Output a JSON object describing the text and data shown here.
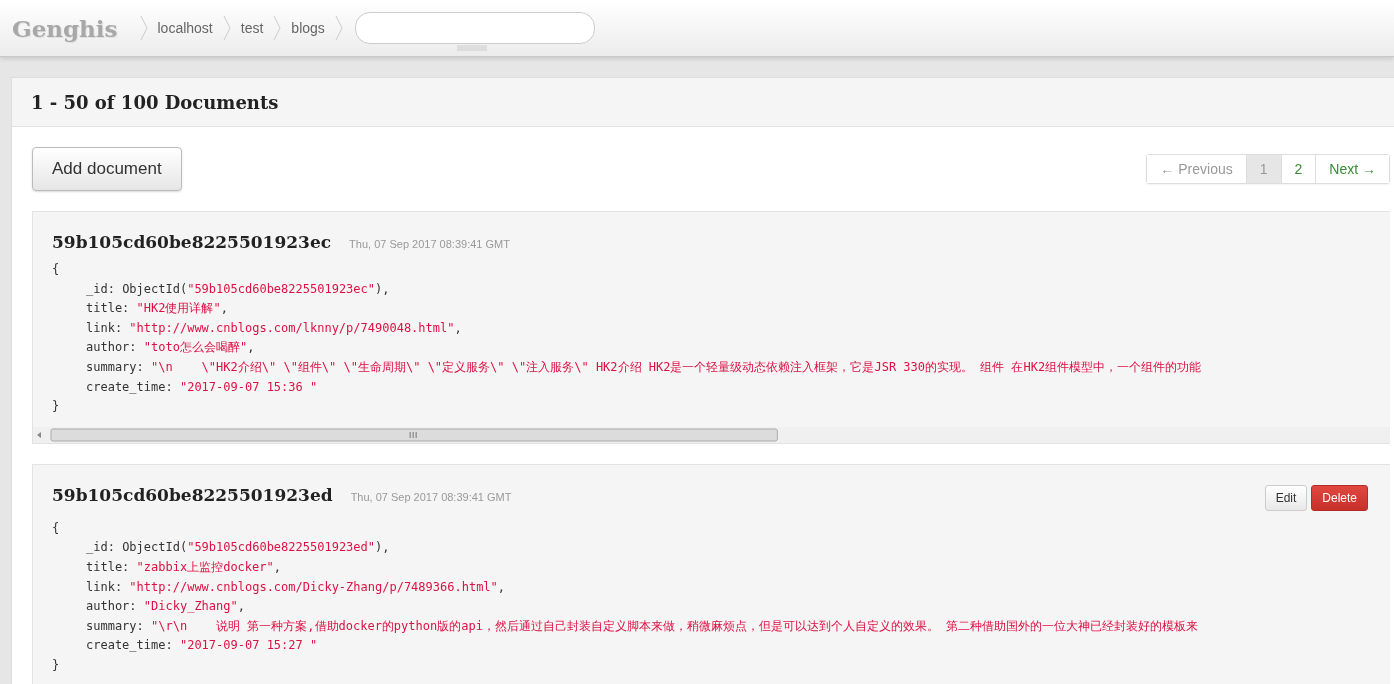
{
  "header": {
    "logo": "Genghis",
    "breadcrumbs": [
      "localhost",
      "test",
      "blogs"
    ]
  },
  "panel": {
    "title": "1 - 50 of 100 Documents",
    "add_button": "Add document",
    "pagination": [
      {
        "label": "← Previous",
        "disabled": true,
        "selected": false
      },
      {
        "label": "1",
        "disabled": false,
        "selected": true
      },
      {
        "label": "2",
        "disabled": false,
        "selected": false
      },
      {
        "label": "Next →",
        "disabled": false,
        "selected": false
      }
    ],
    "documents": [
      {
        "heading": "59b105cd60be8225501923ec",
        "timestamp": "Thu, 07 Sep 2017 08:39:41 GMT",
        "open": "{",
        "close": "}",
        "lines": [
          {
            "key": "_id:",
            "before": "ObjectId(",
            "value": "\"59b105cd60be8225501923ec\"",
            "after": "),"
          },
          {
            "key": "title:",
            "value": "\"HK2使用详解\"",
            "after": ","
          },
          {
            "key": "link:",
            "value": "\"http://www.cnblogs.com/lknny/p/7490048.html\"",
            "after": ","
          },
          {
            "key": "author:",
            "value": "\"toto怎么会喝醉\"",
            "after": ","
          },
          {
            "key": "summary:",
            "value": "\"\\n    \\\"HK2介绍\\\" \\\"组件\\\" \\\"生命周期\\\" \\\"定义服务\\\" \\\"注入服务\\\" HK2介绍 HK2是一个轻量级动态依赖注入框架，它是JSR 330的实现。 组件 在HK2组件模型中，一个组件的功能"
          },
          {
            "key": "create_time:",
            "value": "\"2017-09-07 15:36 \""
          }
        ]
      },
      {
        "heading": "59b105cd60be8225501923ed",
        "timestamp": "Thu, 07 Sep 2017 08:39:41 GMT",
        "actions": [
          {
            "label": "Edit",
            "kind": "edit"
          },
          {
            "label": "Delete",
            "kind": "delete"
          }
        ],
        "open": "{",
        "close": "}",
        "lines": [
          {
            "key": "_id:",
            "before": "ObjectId(",
            "value": "\"59b105cd60be8225501923ed\"",
            "after": "),"
          },
          {
            "key": "title:",
            "value": "\"zabbix上监控docker\"",
            "after": ","
          },
          {
            "key": "link:",
            "value": "\"http://www.cnblogs.com/Dicky-Zhang/p/7489366.html\"",
            "after": ","
          },
          {
            "key": "author:",
            "value": "\"Dicky_Zhang\"",
            "after": ","
          },
          {
            "key": "summary:",
            "value": "\"\\r\\n    说明 第一种方案,借助docker的python版的api，然后通过自己封装自定义脚本来做，稍微麻烦点，但是可以达到个人自定义的效果。 第二种借助国外的一位大神已经封装好的模板来"
          },
          {
            "key": "create_time:",
            "value": "\"2017-09-07 15:27 \""
          }
        ]
      }
    ]
  }
}
